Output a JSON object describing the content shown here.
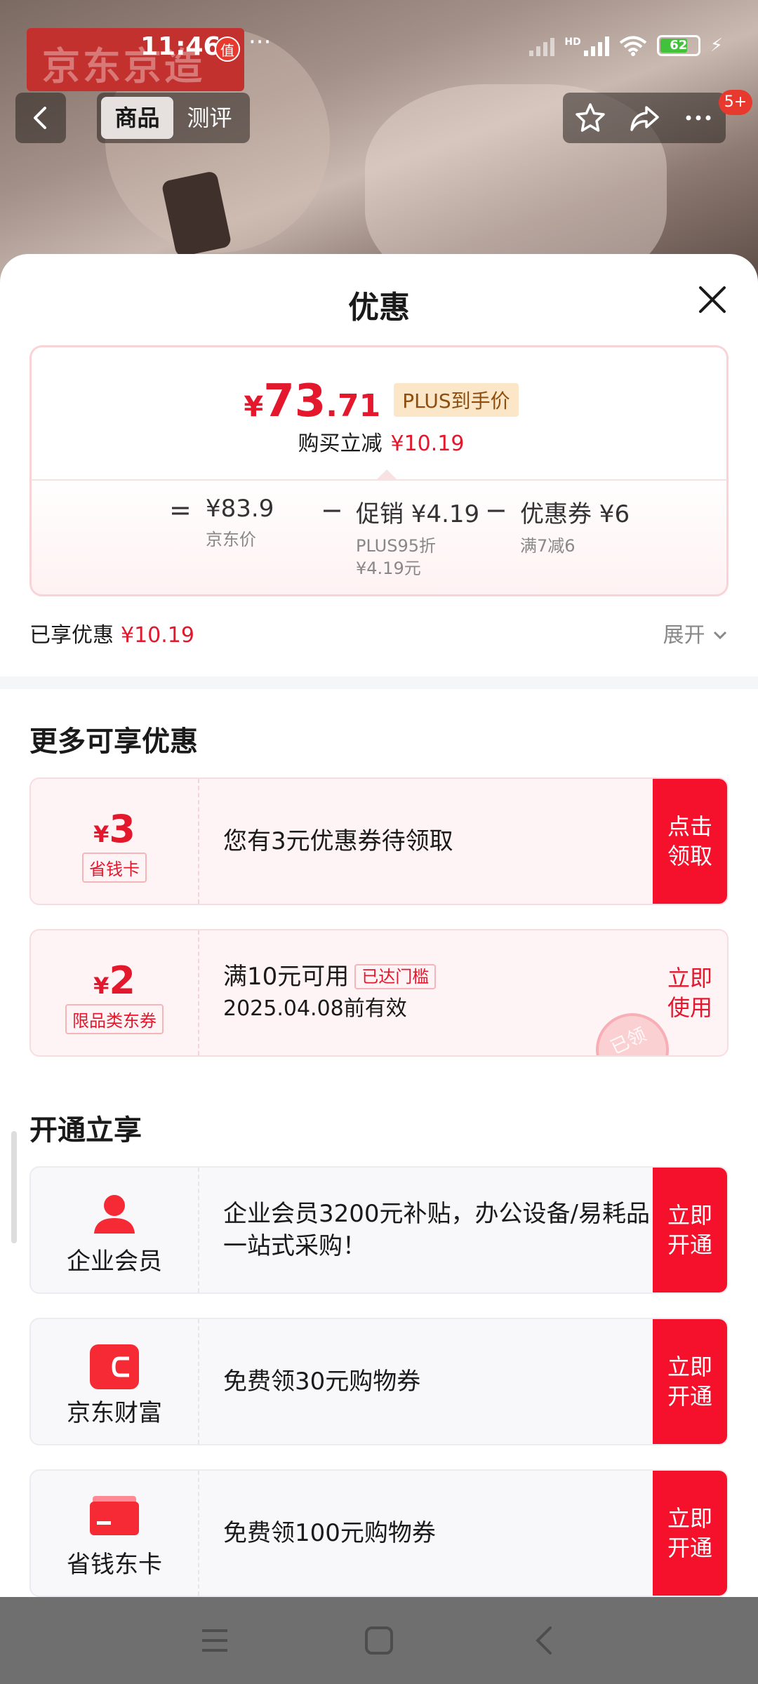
{
  "status_bar": {
    "time": "11:46",
    "app_badge": "值",
    "dots": "···",
    "hd": "HD",
    "battery": "62"
  },
  "background": {
    "logo_text": "京东京造"
  },
  "nav": {
    "tabs": [
      {
        "label": "商品",
        "active": true
      },
      {
        "label": "测评",
        "active": false
      }
    ],
    "cart_badge": "5+"
  },
  "sheet": {
    "title": "优惠",
    "price": {
      "currency": "¥",
      "integer": "73",
      "decimal": ".71",
      "tag": "PLUS到手价",
      "reduce_label": "购买立减",
      "reduce_value": "¥10.19",
      "calc": {
        "eq": "=",
        "minus": "−",
        "items": [
          {
            "value": "¥83.9",
            "sub1": "京东价",
            "sub2": ""
          },
          {
            "value": "促销 ¥4.19",
            "sub1": "PLUS95折",
            "sub2": "¥4.19元"
          },
          {
            "value": "优惠券 ¥6",
            "sub1": "满7减6",
            "sub2": ""
          }
        ]
      }
    },
    "enjoyed_label": "已享优惠",
    "enjoyed_value": "¥10.19",
    "expand_label": "展开",
    "more_title": "更多可享优惠",
    "coupons": [
      {
        "currency": "¥",
        "amount": "3",
        "tag": "省钱卡",
        "text": "您有3元优惠券待领取",
        "sub": "",
        "threshold": "",
        "button": "点击领取"
      },
      {
        "currency": "¥",
        "amount": "2",
        "tag": "限品类东券",
        "text": "满10元可用",
        "threshold": "已达门槛",
        "sub": "2025.04.08前有效",
        "button": "立即使用",
        "stamp": "已领"
      }
    ],
    "open_title": "开通立享",
    "services": [
      {
        "name": "企业会员",
        "icon": "person-icon",
        "text": "企业会员3200元补贴，办公设备/易耗品一站式采购！",
        "button": "立即开通"
      },
      {
        "name": "京东财富",
        "icon": "wallet-icon",
        "text": "免费领30元购物券",
        "button": "立即开通"
      },
      {
        "name": "省钱东卡",
        "icon": "card-icon",
        "text": "免费领100元购物券",
        "button": "立即开通"
      }
    ]
  },
  "colors": {
    "accent": "#e3182d",
    "button": "#f5112b",
    "plus_tag_bg": "#fbe7c8"
  }
}
